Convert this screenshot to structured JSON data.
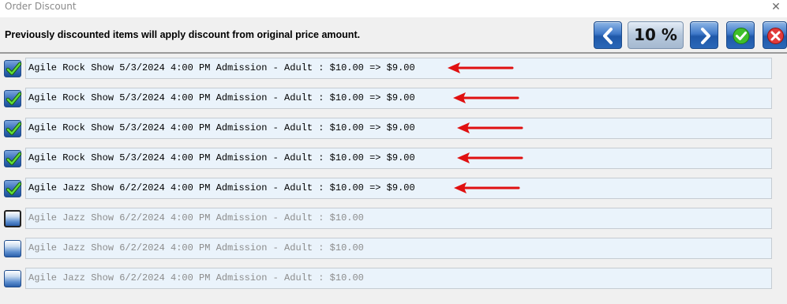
{
  "window": {
    "title": "Order Discount",
    "close_glyph": "✕"
  },
  "header": {
    "message": "Previously discounted items will apply discount from original price amount.",
    "percent": "10 %"
  },
  "toolbar": {
    "prev_icon": "chevron-left-icon",
    "next_icon": "chevron-right-icon",
    "ok_icon": "check-circle-icon",
    "cancel_icon": "close-circle-icon"
  },
  "items": [
    {
      "label": "Agile Rock Show 5/3/2024 4:00 PM Admission - Adult : $10.00 => $9.00",
      "checked": true
    },
    {
      "label": "Agile Rock Show 5/3/2024 4:00 PM Admission - Adult : $10.00 => $9.00",
      "checked": true
    },
    {
      "label": "Agile Rock Show 5/3/2024 4:00 PM Admission - Adult : $10.00 => $9.00",
      "checked": true
    },
    {
      "label": "Agile Rock Show 5/3/2024 4:00 PM Admission - Adult : $10.00 => $9.00",
      "checked": true
    },
    {
      "label": "Agile Jazz Show 6/2/2024 4:00 PM Admission - Adult : $10.00 => $9.00",
      "checked": true
    },
    {
      "label": "Agile Jazz Show 6/2/2024 4:00 PM Admission - Adult : $10.00",
      "checked": false
    },
    {
      "label": "Agile Jazz Show 6/2/2024 4:00 PM Admission - Adult : $10.00",
      "checked": false
    },
    {
      "label": "Agile Jazz Show 6/2/2024 4:00 PM Admission - Adult : $10.00",
      "checked": false
    }
  ],
  "colors": {
    "accent_blue": "#2a67b8",
    "arrow_red": "#e01010",
    "check_green": "#3fbf2a"
  }
}
